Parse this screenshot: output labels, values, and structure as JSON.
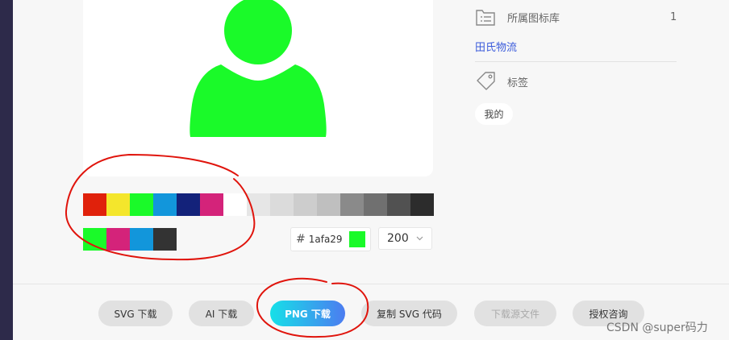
{
  "palette": {
    "colors": [
      "#e0210b",
      "#f4e62c",
      "#1afa29",
      "#1296db",
      "#13227a",
      "#d4237a",
      "#ffffff",
      "#e6e6e6",
      "#dbdbdb",
      "#cdcdcd",
      "#bfbfbf",
      "#8a8a8a",
      "#707070",
      "#515151",
      "#2c2c2c"
    ],
    "recent": [
      "#1afa29",
      "#d4237a",
      "#1296db",
      "#333333"
    ]
  },
  "icon_color": "#1afa29",
  "icon_name": "user-icon",
  "color_input": {
    "hash": "#",
    "value": "1afa29",
    "chip_color": "#1afa29"
  },
  "size_select": {
    "value": "200"
  },
  "buttons": [
    {
      "name": "svg-download-button",
      "label": "SVG 下载",
      "style": "normal"
    },
    {
      "name": "ai-download-button",
      "label": "AI 下载",
      "style": "normal"
    },
    {
      "name": "png-download-button",
      "label": "PNG 下载",
      "style": "primary"
    },
    {
      "name": "copy-svg-code-button",
      "label": "复制 SVG 代码",
      "style": "normal"
    },
    {
      "name": "download-source-button",
      "label": "下载源文件",
      "style": "disabled"
    },
    {
      "name": "license-inquiry-button",
      "label": "授权咨询",
      "style": "normal"
    }
  ],
  "meta": {
    "library_label": "所属图标库",
    "library_count": "1",
    "library_name": "田氏物流",
    "tags_label": "标签",
    "tags": [
      "我的"
    ]
  },
  "watermark": "CSDN @super码力",
  "annotation_color": "#e0140c"
}
